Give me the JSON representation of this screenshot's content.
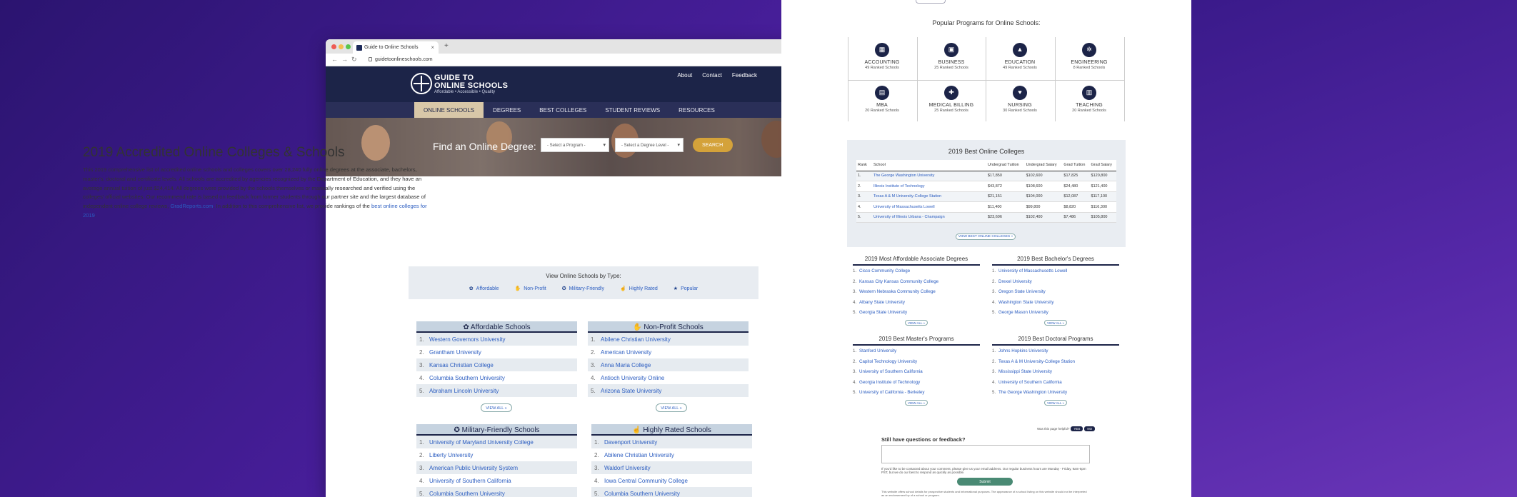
{
  "browser": {
    "tab_title": "Guide to Online Schools",
    "url": "guidetoonlineschools.com"
  },
  "site": {
    "brand_line1": "GUIDE TO",
    "brand_line2": "ONLINE SCHOOLS",
    "brand_tagline": "Affordable • Accessible • Quality",
    "toplinks": [
      "About",
      "Contact",
      "Feedback"
    ],
    "nav": [
      "ONLINE SCHOOLS",
      "DEGREES",
      "BEST COLLEGES",
      "STUDENT REVIEWS",
      "RESOURCES"
    ]
  },
  "hero": {
    "find_label": "Find an Online Degree:",
    "program_select": "- Select a Program -",
    "degree_select": "- Select a Degree Level -",
    "search_label": "SEARCH"
  },
  "main": {
    "title": "2019 Accredited Online Colleges & Schools",
    "intro": "This 2019 comprehensive list of accredited online schools and colleges covers over 28,240 fully online degrees at the associate, bachelors, master's, doctoral and certificate levels. All schools are accredited by agencies recognized by the Department of Education, and they have an average annual tuition of just $24,414. All degrees were provided by the schools themselves or manually researched and verified using the colleges' official websites. Our recommend rate is based on feedback from former students through our partner site and the largest database of independent online college reviews,",
    "intro_link1": "GradReports.com",
    "intro_mid": ". In addition to this comprehensive list, we provide rankings of the",
    "intro_link2": "best online colleges for 2019",
    "intro_end": ".",
    "type_box_title": "View Online Schools by Type:",
    "types": [
      {
        "icon": "piggy-bank-icon",
        "label": "Affordable"
      },
      {
        "icon": "handshake-icon",
        "label": "Non-Profit"
      },
      {
        "icon": "medal-icon",
        "label": "Military-Friendly"
      },
      {
        "icon": "thumbs-up-icon",
        "label": "Highly Rated"
      },
      {
        "icon": "star-icon",
        "label": "Popular"
      }
    ],
    "view_all": "VIEW ALL »",
    "lists": [
      {
        "title": "Affordable Schools",
        "items": [
          "Western Governors University",
          "Grantham University",
          "Kansas Christian College",
          "Columbia Southern University",
          "Abraham Lincoln University"
        ]
      },
      {
        "title": "Non-Profit Schools",
        "items": [
          "Abilene Christian University",
          "American University",
          "Anna Maria College",
          "Antioch University Online",
          "Arizona State University"
        ]
      },
      {
        "title": "Military-Friendly Schools",
        "items": [
          "University of Maryland University College",
          "Liberty University",
          "American Public University System",
          "University of Southern California",
          "Columbia Southern University"
        ]
      },
      {
        "title": "Highly Rated Schools",
        "items": [
          "Davenport University",
          "Abilene Christian University",
          "Waldorf University",
          "Iowa Central Community College",
          "Columbia Southern University"
        ]
      }
    ]
  },
  "right": {
    "popular_title": "Popular Programs for Online Schools:",
    "programs": [
      {
        "name": "ACCOUNTING",
        "count": "49 Ranked Schools"
      },
      {
        "name": "BUSINESS",
        "count": "25 Ranked Schools"
      },
      {
        "name": "EDUCATION",
        "count": "49 Ranked Schools"
      },
      {
        "name": "ENGINEERING",
        "count": "8 Ranked Schools"
      },
      {
        "name": "MBA",
        "count": "20 Ranked Schools"
      },
      {
        "name": "MEDICAL BILLING",
        "count": "25 Ranked Schools"
      },
      {
        "name": "NURSING",
        "count": "30 Ranked Schools"
      },
      {
        "name": "TEACHING",
        "count": "20 Ranked Schools"
      }
    ],
    "best_title": "2019 Best Online Colleges",
    "best_headers": [
      "Rank",
      "School",
      "Undergrad Tuition",
      "Undergrad Salary",
      "Grad Tuition",
      "Grad Salary"
    ],
    "best_rows": [
      [
        "1.",
        "The George Washington University",
        "$17,850",
        "$102,600",
        "$17,825",
        "$120,800"
      ],
      [
        "2.",
        "Illinois Institute of Technology",
        "$43,872",
        "$108,600",
        "$24,480",
        "$121,400"
      ],
      [
        "3.",
        "Texas A & M University-College Station",
        "$21,151",
        "$104,000",
        "$12,087",
        "$117,100"
      ],
      [
        "4.",
        "University of Massachusetts Lowell",
        "$11,400",
        "$99,800",
        "$8,820",
        "$116,300"
      ],
      [
        "5.",
        "University of Illinois Urbana - Champaign",
        "$23,606",
        "$102,400",
        "$7,486",
        "$105,800"
      ]
    ],
    "best_view_all": "VIEW BEST ONLINE COLLEGES »",
    "mini_view_all": "VIEW ALL »",
    "mini_lists": [
      {
        "title": "2019 Most Affordable Associate Degrees",
        "items": [
          "Cisco Community College",
          "Kansas City Kansas Community College",
          "Western Nebraska Community College",
          "Albany State University",
          "Georgia State University"
        ]
      },
      {
        "title": "2019 Best Bachelor's Degrees",
        "items": [
          "University of Massachusetts Lowell",
          "Drexel University",
          "Oregon State University",
          "Washington State University",
          "George Mason University"
        ]
      },
      {
        "title": "2019 Best Master's Programs",
        "items": [
          "Stanford University",
          "Capitol Technology University",
          "University of Southern California",
          "Georgia Institute of Technology",
          "University of California - Berkeley"
        ]
      },
      {
        "title": "2019 Best Doctoral Programs",
        "items": [
          "Johns Hopkins University",
          "Texas A & M University-College Station",
          "Mississippi State University",
          "University of Southern California",
          "The George Washington University"
        ]
      }
    ],
    "helpful_label": "Was this page helpful?",
    "helpful_yes": "YES",
    "helpful_no": "NO",
    "feedback_question": "Still have questions or feedback?",
    "feedback_note": "If you'd like to be contacted about your comment, please give us your email address. Our regular business hours are Monday - Friday, 9am-5pm PST, but we do our best to respond as quickly as possible.",
    "submit_label": "Submit",
    "fine_print": "This website offers school details for prospective students and informational purposes. The appearance of a school listing on this website should not be interpreted as an endorsement by of a school or program."
  }
}
